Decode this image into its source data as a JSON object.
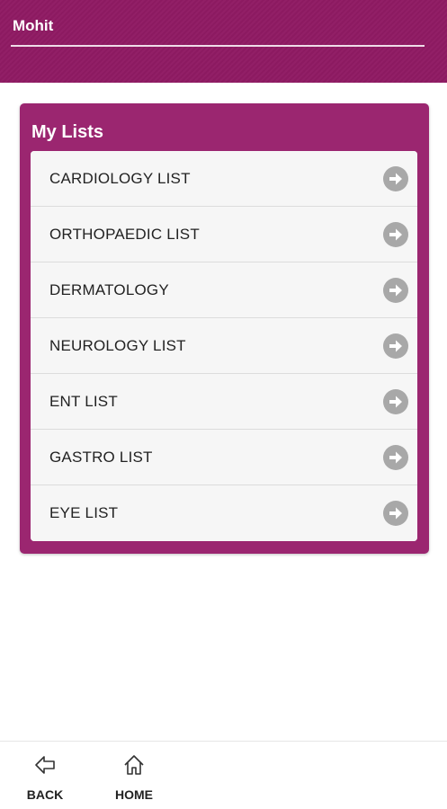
{
  "header": {
    "user_name": "Mohit"
  },
  "panel": {
    "title": "My Lists",
    "items": [
      {
        "label": "CARDIOLOGY LIST"
      },
      {
        "label": "ORTHOPAEDIC LIST"
      },
      {
        "label": "DERMATOLOGY"
      },
      {
        "label": "NEUROLOGY LIST"
      },
      {
        "label": "ENT LIST"
      },
      {
        "label": "GASTRO LIST"
      },
      {
        "label": "EYE LIST"
      }
    ]
  },
  "footer": {
    "back_label": "BACK",
    "home_label": "HOME"
  },
  "colors": {
    "header": "#8f1a63",
    "panel": "#9b2670",
    "list_bg": "#f6f6f6",
    "arrow": "#a8a8a8"
  },
  "icons": {
    "item_arrow": "arrow-right-circle-icon",
    "back": "back-arrow-icon",
    "home": "home-icon"
  }
}
